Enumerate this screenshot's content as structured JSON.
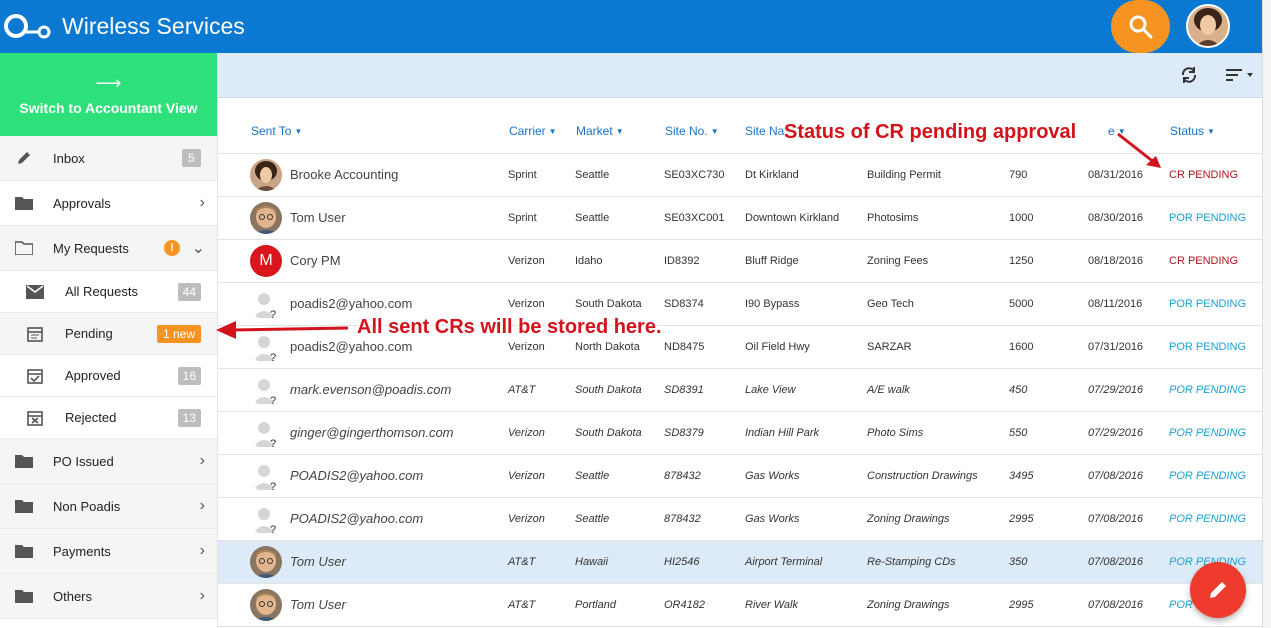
{
  "header": {
    "app_title": "Wireless Services",
    "search_icon": "search-icon",
    "brand_color": "#0b78d1",
    "accent_color": "#f79421"
  },
  "sidebar": {
    "switch_label": "Switch to Accountant View",
    "items": [
      {
        "label": "Inbox",
        "icon": "pencil-icon",
        "badge": "5"
      },
      {
        "label": "Approvals",
        "icon": "folder-icon"
      },
      {
        "label": "My Requests",
        "icon": "folder-open-icon",
        "alert": "!"
      },
      {
        "label": "All Requests",
        "icon": "mail-icon",
        "badge": "44"
      },
      {
        "label": "Pending",
        "icon": "calendar-icon",
        "badge": "1 new"
      },
      {
        "label": "Approved",
        "icon": "calendar-check-icon",
        "badge": "16"
      },
      {
        "label": "Rejected",
        "icon": "calendar-x-icon",
        "badge": "13"
      },
      {
        "label": "PO Issued",
        "icon": "folder-icon"
      },
      {
        "label": "Non Poadis",
        "icon": "folder-icon"
      },
      {
        "label": "Payments",
        "icon": "folder-icon"
      },
      {
        "label": "Others",
        "icon": "folder-icon"
      }
    ]
  },
  "table": {
    "headers": {
      "sent_to": "Sent To",
      "carrier": "Carrier",
      "market": "Market",
      "site_no": "Site No.",
      "site_name": "Site Na",
      "col6": "",
      "col7": "",
      "date": "e",
      "status": "Status"
    },
    "rows": [
      {
        "sent_to": "Brooke Accounting",
        "avatar": "photo-woman",
        "carrier": "Sprint",
        "market": "Seattle",
        "site_no": "SE03XC730",
        "site_name": "Dt Kirkland",
        "type": "Building Permit",
        "amount": "790",
        "date": "08/31/2016",
        "status": "CR PENDING",
        "kind": "cr",
        "italic": false
      },
      {
        "sent_to": "Tom User",
        "avatar": "photo-man",
        "carrier": "Sprint",
        "market": "Seattle",
        "site_no": "SE03XC001",
        "site_name": "Downtown Kirkland",
        "type": "Photosims",
        "amount": "1000",
        "date": "08/30/2016",
        "status": "POR PENDING",
        "kind": "por",
        "italic": false
      },
      {
        "sent_to": "Cory PM",
        "avatar": "letter-m",
        "carrier": "Verizon",
        "market": "Idaho",
        "site_no": "ID8392",
        "site_name": "Bluff Ridge",
        "type": "Zoning Fees",
        "amount": "1250",
        "date": "08/18/2016",
        "status": "CR PENDING",
        "kind": "cr",
        "italic": false
      },
      {
        "sent_to": "poadis2@yahoo.com",
        "avatar": "unknown",
        "carrier": "Verizon",
        "market": "South Dakota",
        "site_no": "SD8374",
        "site_name": "I90 Bypass",
        "type": "Geo Tech",
        "amount": "5000",
        "date": "08/11/2016",
        "status": "POR PENDING",
        "kind": "por",
        "italic": false
      },
      {
        "sent_to": "poadis2@yahoo.com",
        "avatar": "unknown",
        "carrier": "Verizon",
        "market": "North Dakota",
        "site_no": "ND8475",
        "site_name": "Oil Field Hwy",
        "type": "SARZAR",
        "amount": "1600",
        "date": "07/31/2016",
        "status": "POR PENDING",
        "kind": "por",
        "italic": false
      },
      {
        "sent_to": "mark.evenson@poadis.com",
        "avatar": "unknown",
        "carrier": "AT&T",
        "market": "South Dakota",
        "site_no": "SD8391",
        "site_name": "Lake View",
        "type": "A/E walk",
        "amount": "450",
        "date": "07/29/2016",
        "status": "POR PENDING",
        "kind": "por",
        "italic": true
      },
      {
        "sent_to": "ginger@gingerthomson.com",
        "avatar": "unknown",
        "carrier": "Verizon",
        "market": "South Dakota",
        "site_no": "SD8379",
        "site_name": "Indian Hill Park",
        "type": "Photo Sims",
        "amount": "550",
        "date": "07/29/2016",
        "status": "POR PENDING",
        "kind": "por",
        "italic": true
      },
      {
        "sent_to": "POADIS2@yahoo.com",
        "avatar": "unknown",
        "carrier": "Verizon",
        "market": "Seattle",
        "site_no": "878432",
        "site_name": "Gas Works",
        "type": "Construction Drawings",
        "amount": "3495",
        "date": "07/08/2016",
        "status": "POR PENDING",
        "kind": "por",
        "italic": true
      },
      {
        "sent_to": "POADIS2@yahoo.com",
        "avatar": "unknown",
        "carrier": "Verizon",
        "market": "Seattle",
        "site_no": "878432",
        "site_name": "Gas Works",
        "type": "Zoning Drawings",
        "amount": "2995",
        "date": "07/08/2016",
        "status": "POR PENDING",
        "kind": "por",
        "italic": true
      },
      {
        "sent_to": "Tom User",
        "avatar": "photo-man",
        "carrier": "AT&T",
        "market": "Hawaii",
        "site_no": "HI2546",
        "site_name": "Airport Terminal",
        "type": "Re-Stamping CDs",
        "amount": "350",
        "date": "07/08/2016",
        "status": "POR PENDING",
        "kind": "por",
        "italic": true,
        "selected": true
      },
      {
        "sent_to": "Tom User",
        "avatar": "photo-man",
        "carrier": "AT&T",
        "market": "Portland",
        "site_no": "OR4182",
        "site_name": "River Walk",
        "type": "Zoning Drawings",
        "amount": "2995",
        "date": "07/08/2016",
        "status": "POR",
        "kind": "por",
        "italic": true
      }
    ]
  },
  "annotations": {
    "status_note": "Status of CR pending approval",
    "pending_note": "All sent CRs will be stored here."
  },
  "avatar_letter": "M"
}
